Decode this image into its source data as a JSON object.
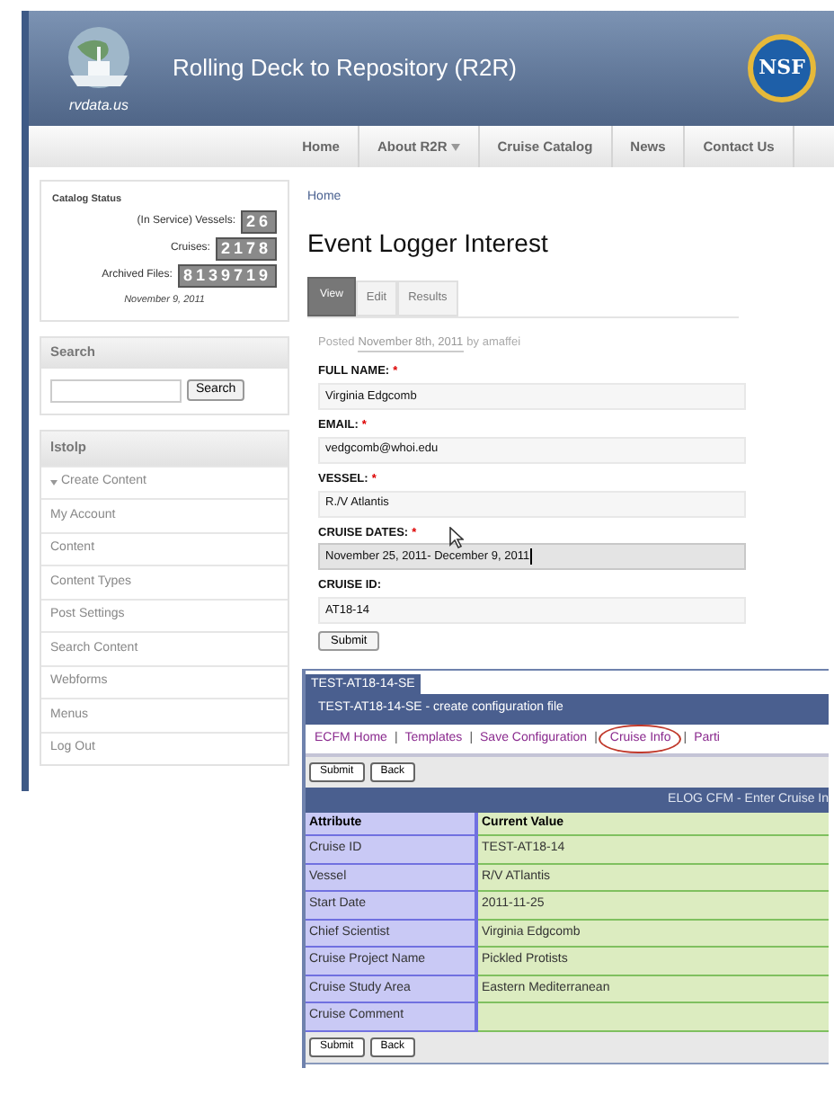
{
  "header": {
    "logo_text": "rvdata.us",
    "title": "Rolling Deck to Repository (R2R)",
    "badge_text": "NSF"
  },
  "nav": [
    {
      "label": "Home",
      "dropdown": false
    },
    {
      "label": "About R2R",
      "dropdown": true
    },
    {
      "label": "Cruise Catalog",
      "dropdown": false
    },
    {
      "label": "News",
      "dropdown": false
    },
    {
      "label": "Contact Us",
      "dropdown": false
    }
  ],
  "catalog_status": {
    "title": "Catalog Status",
    "rows": [
      {
        "label": "(In Service) Vessels:",
        "value": "26"
      },
      {
        "label": "Cruises:",
        "value": "2178"
      },
      {
        "label": "Archived Files:",
        "value": "8139719"
      }
    ],
    "date": "November 9, 2011"
  },
  "search": {
    "title": "Search",
    "button": "Search"
  },
  "user_menu": {
    "title": "lstolp",
    "items": [
      {
        "label": "Create Content",
        "expanded": true
      },
      {
        "label": "My Account",
        "expanded": false
      },
      {
        "label": "Content",
        "expanded": false
      },
      {
        "label": "Content Types",
        "expanded": false
      },
      {
        "label": "Post Settings",
        "expanded": false
      },
      {
        "label": "Search Content",
        "expanded": false
      },
      {
        "label": "Webforms",
        "expanded": false
      },
      {
        "label": "Menus",
        "expanded": false
      },
      {
        "label": "Log Out",
        "expanded": false
      }
    ]
  },
  "breadcrumb": "Home",
  "page_title": "Event Logger Interest",
  "tabs": [
    {
      "label": "View",
      "selected": true
    },
    {
      "label": "Edit",
      "selected": false
    },
    {
      "label": "Results",
      "selected": false
    }
  ],
  "posted": {
    "prefix": "Posted",
    "date": "November 8th, 2011",
    "author": "by amaffei"
  },
  "form": {
    "required_mark": "*",
    "fields": [
      {
        "label": "FULL NAME:",
        "required": true,
        "value": "Virginia Edgcomb",
        "focused": false
      },
      {
        "label": "EMAIL:",
        "required": true,
        "value": "vedgcomb@whoi.edu",
        "focused": false
      },
      {
        "label": "VESSEL:",
        "required": true,
        "value": "R./V Atlantis",
        "focused": false
      },
      {
        "label": "CRUISE DATES:",
        "required": true,
        "value": "November 25, 2011- December 9, 2011",
        "focused": true
      },
      {
        "label": "CRUISE ID:",
        "required": false,
        "value": "AT18-14",
        "focused": false
      }
    ],
    "submit": "Submit"
  },
  "inset": {
    "tab": "TEST-AT18-14-SE",
    "title": "TEST-AT18-14-SE - create configuration file",
    "separator": "|",
    "links": [
      {
        "label": "ECFM Home",
        "circled": false
      },
      {
        "label": "Templates",
        "circled": false
      },
      {
        "label": "Save Configuration",
        "circled": false
      },
      {
        "label": "Cruise Info",
        "circled": true
      },
      {
        "label": "Parti",
        "circled": false
      }
    ],
    "top_buttons": [
      "Submit",
      "Back"
    ],
    "banner": "ELOG CFM - Enter Cruise In",
    "table": {
      "columns": [
        "Attribute",
        "Current Value"
      ],
      "rows": [
        [
          "Cruise ID",
          "TEST-AT18-14"
        ],
        [
          "Vessel",
          "R/V ATlantis"
        ],
        [
          "Start Date",
          "2011-11-25"
        ],
        [
          "Chief Scientist",
          "Virginia Edgcomb"
        ],
        [
          "Cruise Project Name",
          "Pickled Protists"
        ],
        [
          "Cruise Study Area",
          "Eastern Mediterranean"
        ],
        [
          "Cruise Comment",
          ""
        ]
      ]
    },
    "bottom_buttons": [
      "Submit",
      "Back"
    ]
  }
}
